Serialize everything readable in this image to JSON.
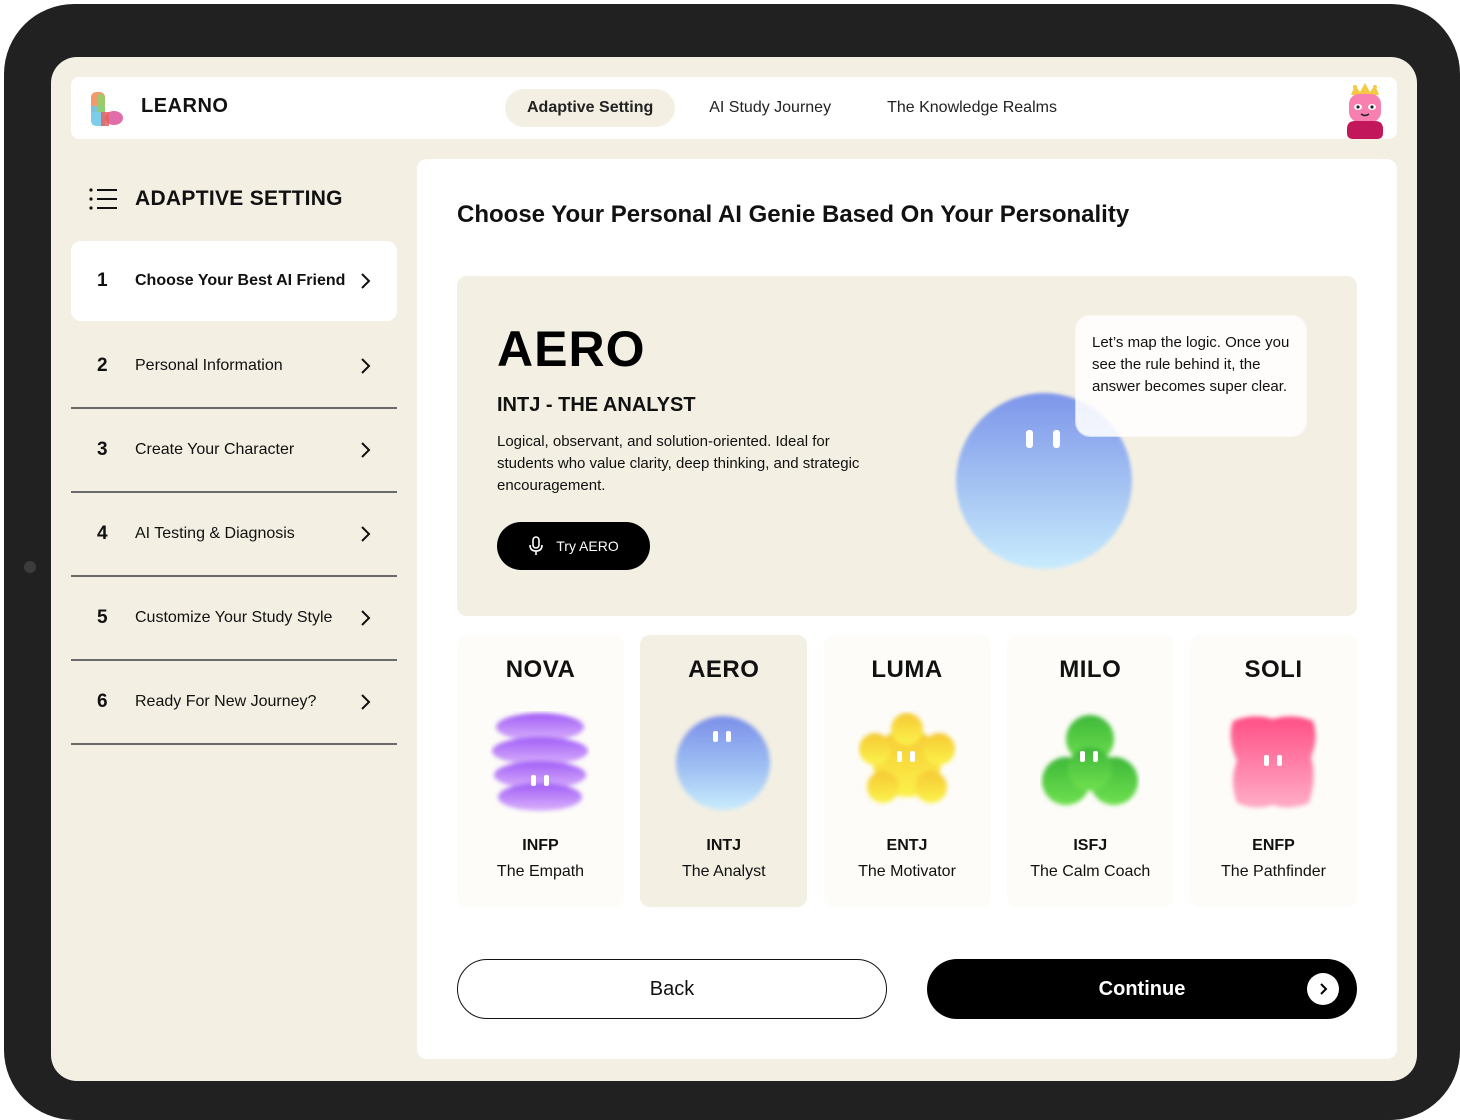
{
  "app": {
    "brand": "LEARNO",
    "nav": [
      {
        "label": "Adaptive Setting",
        "active": true
      },
      {
        "label": "AI Study Journey",
        "active": false
      },
      {
        "label": "The Knowledge Realms",
        "active": false
      }
    ]
  },
  "sidebar": {
    "title": "ADAPTIVE SETTING",
    "steps": [
      {
        "num": "1",
        "label": "Choose Your Best AI Friend",
        "active": true
      },
      {
        "num": "2",
        "label": "Personal Information",
        "active": false
      },
      {
        "num": "3",
        "label": "Create Your Character",
        "active": false
      },
      {
        "num": "4",
        "label": "AI Testing & Diagnosis",
        "active": false
      },
      {
        "num": "5",
        "label": "Customize Your Study Style",
        "active": false
      },
      {
        "num": "6",
        "label": "Ready For New Journey?",
        "active": false
      }
    ]
  },
  "main": {
    "title": "Choose Your Personal AI Genie Based On Your Personality",
    "hero": {
      "name": "AERO",
      "type": "INTJ - THE ANALYST",
      "description": "Logical, observant, and solution-oriented. Ideal for students who value clarity, deep thinking, and strategic encouragement.",
      "try_label": "Try AERO",
      "bubble": "Let’s map the logic. Once you see the rule behind it, the answer becomes super clear."
    },
    "characters": [
      {
        "name": "NOVA",
        "type": "INFP",
        "role": "The Empath",
        "selected": false,
        "color": "#a36ef5"
      },
      {
        "name": "AERO",
        "type": "INTJ",
        "role": "The Analyst",
        "selected": true,
        "color": "#7e96ea"
      },
      {
        "name": "LUMA",
        "type": "ENTJ",
        "role": "The Motivator",
        "selected": false,
        "color": "#f7d23e"
      },
      {
        "name": "MILO",
        "type": "ISFJ",
        "role": "The Calm Coach",
        "selected": false,
        "color": "#4fcf3a"
      },
      {
        "name": "SOLI",
        "type": "ENFP",
        "role": "The Pathfinder",
        "selected": false,
        "color": "#ff5c8f"
      }
    ],
    "back_label": "Back",
    "continue_label": "Continue"
  },
  "colors": {
    "background": "#f3efe3",
    "frame": "#212121",
    "accent": "#000000"
  }
}
